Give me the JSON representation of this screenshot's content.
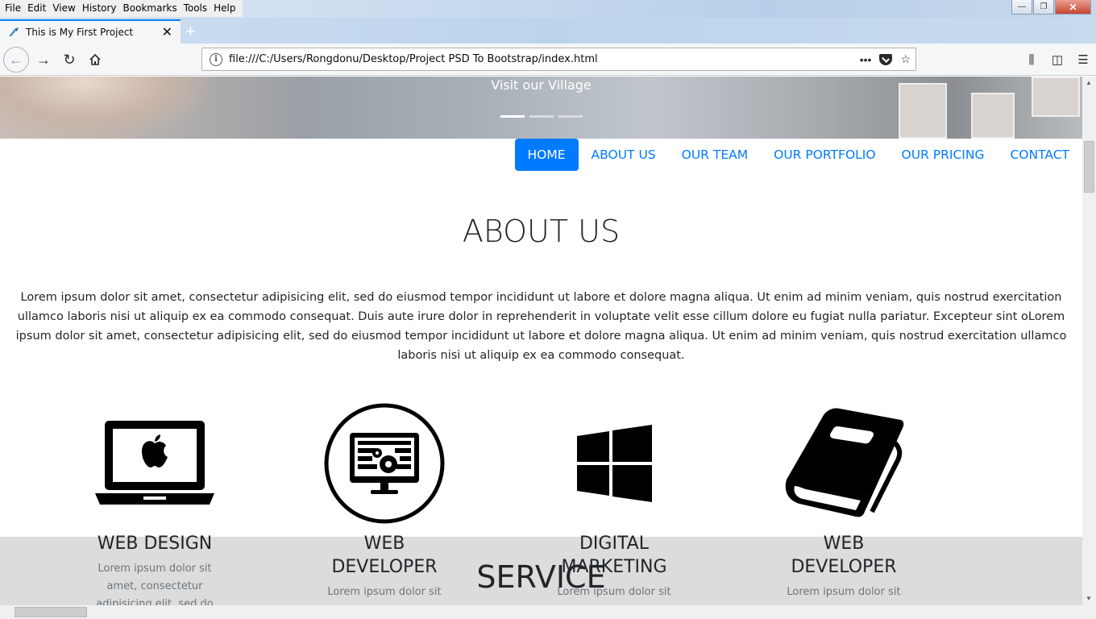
{
  "browser": {
    "menu": [
      "File",
      "Edit",
      "View",
      "History",
      "Bookmarks",
      "Tools",
      "Help"
    ],
    "tab_title": "This is My First Project",
    "url": "file:///C:/Users/Rongdonu/Desktop/Project PSD To Bootstrap/index.html",
    "more_glyph": "•••",
    "window_controls": {
      "minimize": "—",
      "maximize": "❐",
      "close": "✕"
    }
  },
  "hero": {
    "caption": "Visit our Village",
    "slides": 3,
    "active_slide": 1
  },
  "site_nav": {
    "items": [
      "HOME",
      "ABOUT US",
      "OUR TEAM",
      "OUR PORTFOLIO",
      "OUR PRICING",
      "CONTACT"
    ],
    "active": "HOME"
  },
  "about": {
    "title": "ABOUT US",
    "text": "Lorem ipsum dolor sit amet, consectetur adipisicing elit, sed do eiusmod tempor incididunt ut labore et dolore magna aliqua. Ut enim ad minim veniam, quis nostrud exercitation ullamco laboris nisi ut aliquip ex ea commodo consequat. Duis aute irure dolor in reprehenderit in voluptate velit esse cillum dolore eu fugiat nulla pariatur. Excepteur sint oLorem ipsum dolor sit amet, consectetur adipisicing elit, sed do eiusmod tempor incididunt ut labore et dolore magna aliqua. Ut enim ad minim veniam, quis nostrud exercitation ullamco laboris nisi ut aliquip ex ea commodo consequat."
  },
  "features": [
    {
      "icon": "laptop-apple-icon",
      "title": "WEB DESIGN",
      "text": "Lorem ipsum dolor sit amet, consectetur adipisicing elit, sed do"
    },
    {
      "icon": "monitor-gears-icon",
      "title": "WEB DEVELOPER",
      "text": "Lorem ipsum dolor sit"
    },
    {
      "icon": "windows-logo-icon",
      "title": "DIGITAL MARKETING",
      "text": "Lorem ipsum dolor sit"
    },
    {
      "icon": "book-icon",
      "title": "WEB DEVELOPER",
      "text": "Lorem ipsum dolor sit"
    }
  ],
  "service": {
    "title": "SERVICE"
  },
  "colors": {
    "accent": "#007bff",
    "band": "#dcdcdc",
    "text": "#212529",
    "muted": "#6c757d"
  }
}
